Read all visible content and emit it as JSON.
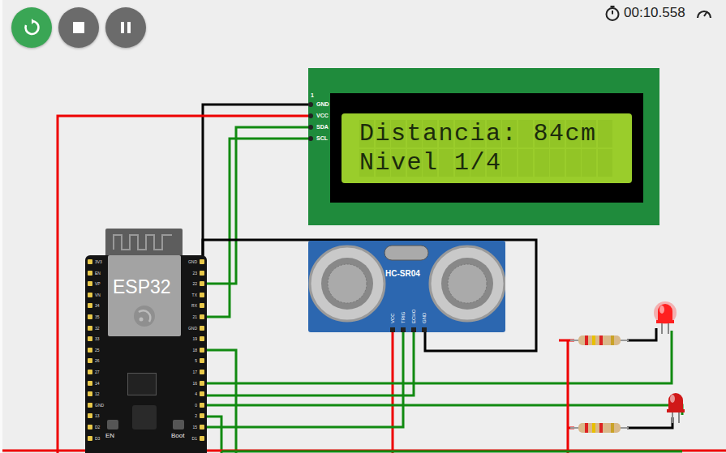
{
  "toolbar": {
    "buttons": [
      {
        "kind": "restart",
        "highlighted": true
      },
      {
        "kind": "stop",
        "highlighted": false
      },
      {
        "kind": "pause",
        "highlighted": false
      }
    ]
  },
  "timer": "00:10.558",
  "lcd": {
    "marker": "1",
    "pins": [
      "GND",
      "VCC",
      "SDA",
      "SCL"
    ],
    "lines": [
      "Distancia: 84cm",
      "Nivel 1/4"
    ]
  },
  "esp32": {
    "label": "ESP32",
    "left_pins": [
      "3V3",
      "EN",
      "VP",
      "VN",
      "34",
      "35",
      "32",
      "33",
      "25",
      "26",
      "27",
      "14",
      "12",
      "GND",
      "13",
      "D2",
      "D3"
    ],
    "right_pins": [
      "GND",
      "23",
      "22",
      "TX",
      "RX",
      "21",
      "GND",
      "19",
      "18",
      "5",
      "17",
      "16",
      "4",
      "0",
      "2",
      "15",
      "D1"
    ],
    "buttons": [
      "EN",
      "Boot"
    ]
  },
  "sensor": {
    "label": "HC-SR04",
    "pins": [
      "VCC",
      "TRIG",
      "ECHO",
      "GND"
    ]
  },
  "leds": [
    {
      "on": true
    },
    {
      "on": false
    }
  ]
}
